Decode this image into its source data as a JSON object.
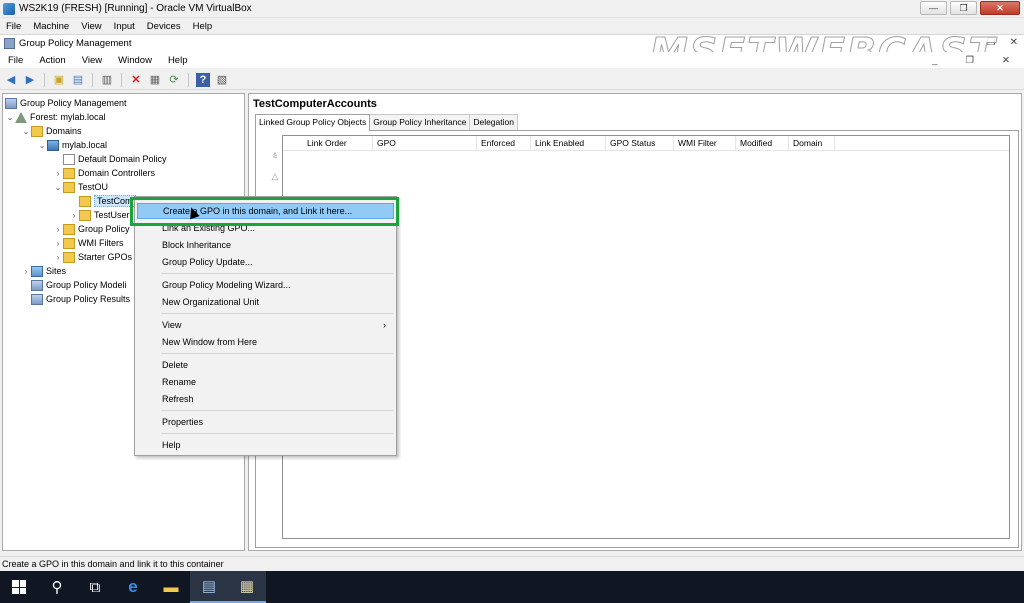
{
  "vbox": {
    "title": "WS2K19 (FRESH) [Running] - Oracle VM VirtualBox",
    "menu": [
      "File",
      "Machine",
      "View",
      "Input",
      "Devices",
      "Help"
    ],
    "buttons": {
      "minimize": "—",
      "maximize": "❐",
      "close": "✕"
    }
  },
  "watermark": "MSFTWEBCAST",
  "gpm": {
    "title": "Group Policy Management",
    "menu": [
      "File",
      "Action",
      "View",
      "Window",
      "Help"
    ]
  },
  "tree": {
    "items": [
      {
        "label": "Group Policy Management",
        "icon": "gpm-icon"
      },
      {
        "label": "Forest: mylab.local",
        "icon": "forest-icon"
      },
      {
        "label": "Domains",
        "icon": "folder-icon"
      },
      {
        "label": "mylab.local",
        "icon": "domain-icon"
      },
      {
        "label": "Default Domain Policy",
        "icon": "gpo-link-icon"
      },
      {
        "label": "Domain Controllers",
        "icon": "ou-icon"
      },
      {
        "label": "TestOU",
        "icon": "ou-icon"
      },
      {
        "label": "TestCom",
        "icon": "ou-icon"
      },
      {
        "label": "TestUser",
        "icon": "ou-icon"
      },
      {
        "label": "Group Policy",
        "icon": "folder-icon"
      },
      {
        "label": "WMI Filters",
        "icon": "folder-icon"
      },
      {
        "label": "Starter GPOs",
        "icon": "folder-icon"
      },
      {
        "label": "Sites",
        "icon": "sites-icon"
      },
      {
        "label": "Group Policy Modeli",
        "icon": "gpm-icon"
      },
      {
        "label": "Group Policy Results",
        "icon": "gpm-icon"
      }
    ]
  },
  "details": {
    "title": "TestComputerAccounts",
    "tabs": [
      "Linked Group Policy Objects",
      "Group Policy Inheritance",
      "Delegation"
    ],
    "columns": [
      "Link Order",
      "GPO",
      "Enforced",
      "Link Enabled",
      "GPO Status",
      "WMI Filter",
      "Modified",
      "Domain"
    ]
  },
  "context_menu": {
    "items": [
      {
        "label": "Create a GPO in this domain, and Link it here...",
        "highlighted": true
      },
      {
        "label": "Link an Existing GPO..."
      },
      {
        "label": "Block Inheritance"
      },
      {
        "label": "Group Policy Update..."
      },
      {
        "label": "Group Policy Modeling Wizard..."
      },
      {
        "label": "New Organizational Unit"
      },
      {
        "label": "View",
        "submenu": true
      },
      {
        "label": "New Window from Here"
      },
      {
        "label": "Delete"
      },
      {
        "label": "Rename"
      },
      {
        "label": "Refresh"
      },
      {
        "label": "Properties"
      },
      {
        "label": "Help"
      }
    ],
    "submenu_arrow": "›"
  },
  "statusbar": {
    "text": "Create a GPO in this domain and link it to this container"
  },
  "colors": {
    "highlight_box": "#1aa53a",
    "menu_highlight": "#91c9f7",
    "taskbar": "#101722"
  }
}
